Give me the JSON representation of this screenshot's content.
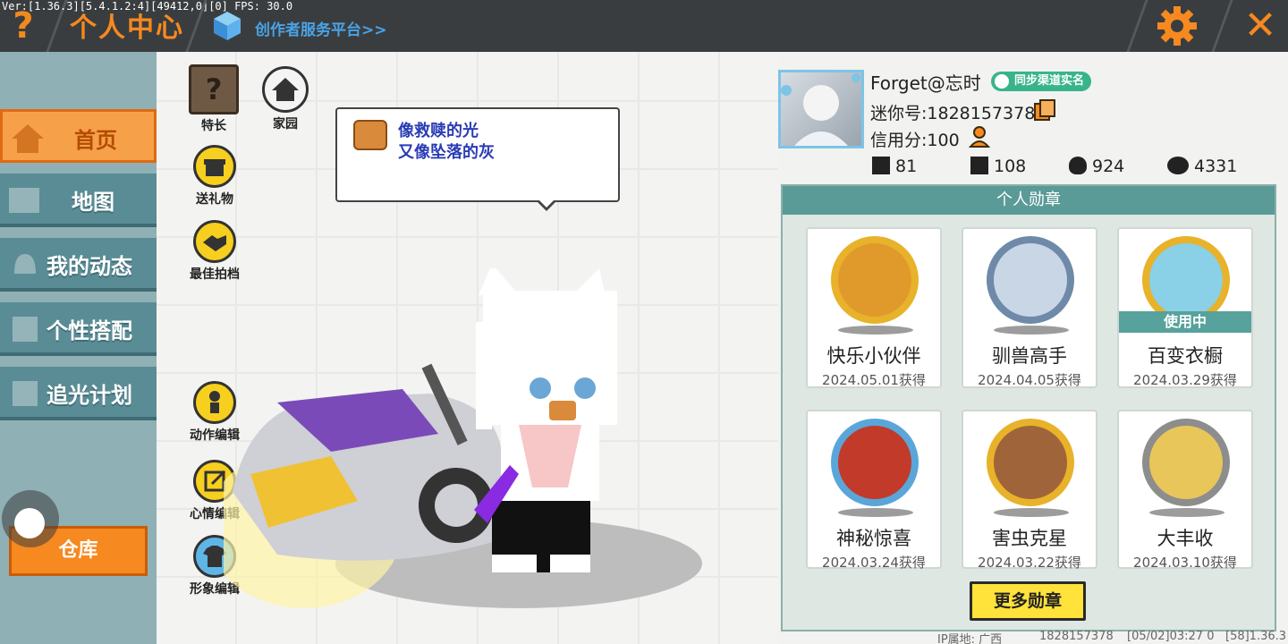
{
  "topbar": {
    "version": "Ver:[1.36.3][5.4.1.2:4][49412,0][0] FPS: 30.0",
    "help": "?",
    "title": "个人中心",
    "creator_link": "创作者服务平台>>",
    "close": "✕"
  },
  "sidebar": {
    "items": [
      {
        "label": "首页",
        "active": true,
        "icon": "home-icon"
      },
      {
        "label": "地图",
        "active": false,
        "icon": "map-icon"
      },
      {
        "label": "我的动态",
        "active": false,
        "icon": "bell-icon"
      },
      {
        "label": "个性搭配",
        "active": false,
        "icon": "outfit-icon"
      },
      {
        "label": "追光计划",
        "active": false,
        "icon": "plan-icon"
      }
    ],
    "warehouse": "仓库"
  },
  "main": {
    "tools": [
      {
        "label": "特长",
        "icon": "question-block-icon"
      },
      {
        "label": "家园",
        "icon": "house-icon"
      },
      {
        "label": "送礼物",
        "icon": "gift-icon"
      },
      {
        "label": "最佳拍档",
        "icon": "handshake-icon"
      },
      {
        "label": "动作编辑",
        "icon": "action-icon"
      },
      {
        "label": "心情编辑",
        "icon": "edit-icon"
      },
      {
        "label": "形象编辑",
        "icon": "shirt-icon"
      }
    ],
    "speech": {
      "line1": "像救赎的光",
      "line2": "又像坠落的灰"
    }
  },
  "profile": {
    "username": "Forget@忘时",
    "real_name_badge": "同步渠道实名",
    "mini_id": "迷你号:1828157378",
    "credit": "信用分:100",
    "stats": [
      "81",
      "108",
      "924",
      "4331"
    ]
  },
  "medals": {
    "title": "个人勋章",
    "items": [
      {
        "name": "快乐小伙伴",
        "date": "2024.05.01获得"
      },
      {
        "name": "驯兽高手",
        "date": "2024.04.05获得"
      },
      {
        "name": "百变衣橱",
        "date": "2024.03.29获得",
        "status": "使用中"
      },
      {
        "name": "神秘惊喜",
        "date": "2024.03.24获得"
      },
      {
        "name": "害虫克星",
        "date": "2024.03.22获得"
      },
      {
        "name": "大丰收",
        "date": "2024.03.10获得"
      }
    ],
    "more_button": "更多勋章"
  },
  "footer": {
    "ip": "IP属地: 广西",
    "uid": "1828157378",
    "time": "[05/02]03:27 0",
    "build": "[58]1.36.3"
  },
  "colors": {
    "accent": "#f6891f",
    "sidebar": "#5a8c95",
    "medal_header": "#5a9a97",
    "badge_green": "#38b48b"
  }
}
